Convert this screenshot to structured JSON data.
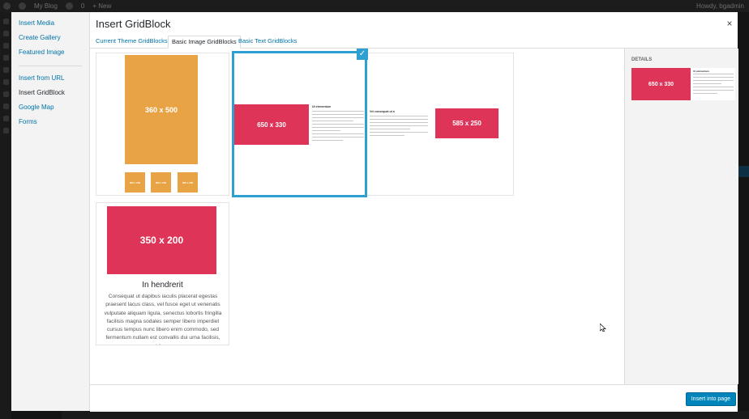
{
  "admin_bar": {
    "left_items": [
      "My Blog",
      "0",
      "+ New"
    ],
    "greeting": "Howdy, bgadmin"
  },
  "modal": {
    "title": "Insert GridBlock",
    "close_symbol": "×",
    "menu": {
      "group1": [
        "Insert Media",
        "Create Gallery",
        "Featured Image"
      ],
      "group2": [
        "Insert from URL",
        "Insert GridBlock",
        "Google Map",
        "Forms"
      ],
      "active": "Insert GridBlock"
    },
    "tabs": [
      "Current Theme GridBlocks",
      "Basic Image GridBlocks",
      "Basic Text GridBlocks"
    ],
    "active_tab": "Basic Image GridBlocks",
    "blocks": {
      "b1": {
        "main": "360 x 500",
        "thumbs": [
          "350 x 200",
          "350 x 200",
          "350 x 200"
        ]
      },
      "b2": {
        "image": "650 x 330",
        "heading": "Ut elementum",
        "selected": true
      },
      "b3": {
        "image": "585 x 250",
        "heading": "Vel consequat ut a"
      },
      "b4": {
        "image": "350 x 200",
        "heading": "In hendrerit",
        "text": "Consequat ut dapibus iaculis placerat egestas praesent lacus class, vel fusce eget ut venenatis vulputate aliquam ligula, senectus lobortis fringilla facilisis magna sodales semper libero imperdiet cursus tempus nunc libero enim commodo, sed fermentum nullam est convallis dui urna facilisis, mi fames."
      }
    },
    "details": {
      "label": "DETAILS",
      "image": "650 x 330",
      "heading": "Ut elementum"
    },
    "footer": {
      "insert_button": "Insert into page"
    },
    "colors": {
      "accent": "#0085ba",
      "selection": "#2e9fd1",
      "orange": "#e8a444",
      "red": "#dd3457"
    }
  }
}
